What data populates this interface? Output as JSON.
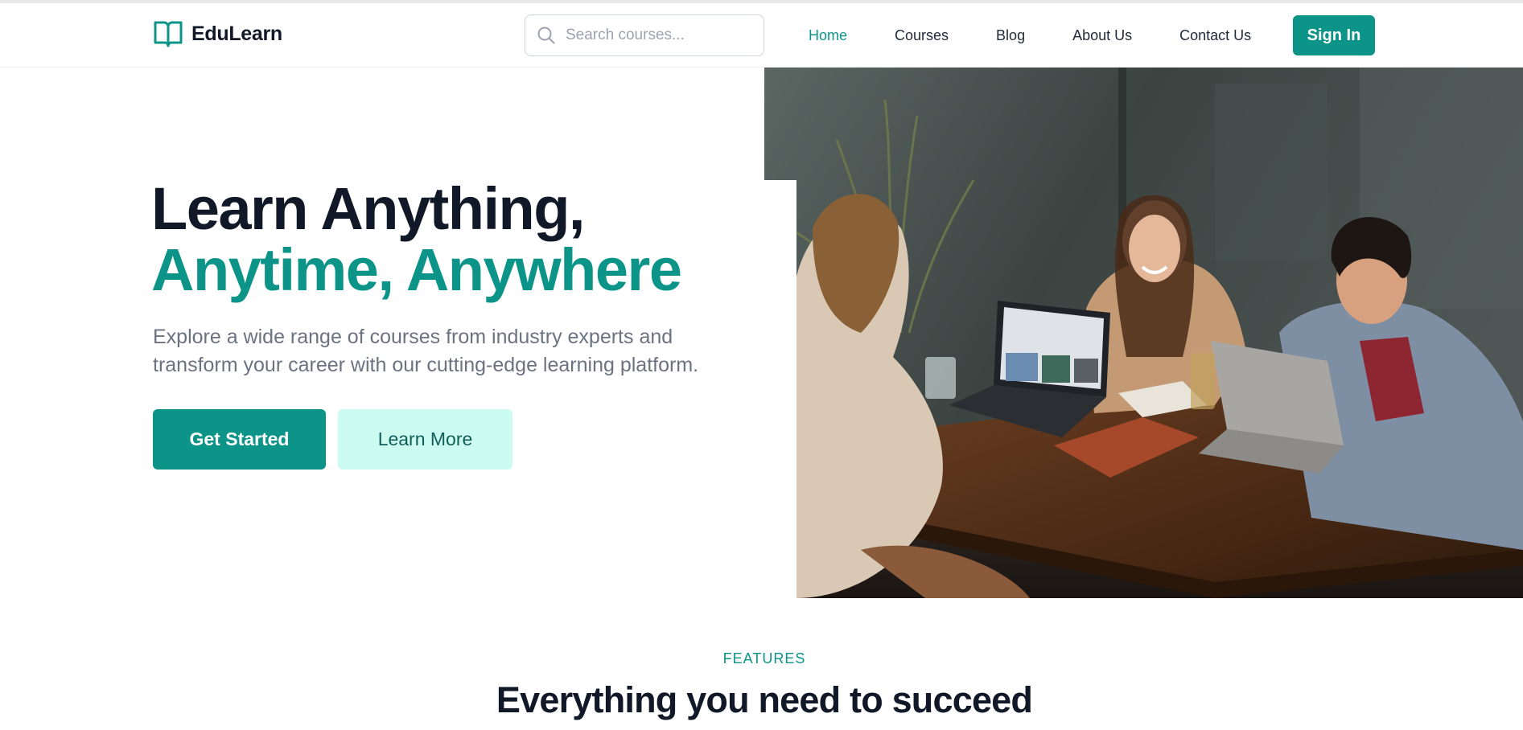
{
  "brand": {
    "name": "EduLearn",
    "icon": "open-book-icon",
    "color": "#0d9488"
  },
  "search": {
    "placeholder": "Search courses...",
    "value": "",
    "icon": "search-icon"
  },
  "nav": {
    "items": [
      {
        "label": "Home",
        "active": true
      },
      {
        "label": "Courses",
        "active": false
      },
      {
        "label": "Blog",
        "active": false
      },
      {
        "label": "About Us",
        "active": false
      },
      {
        "label": "Contact Us",
        "active": false
      }
    ],
    "signin_label": "Sign In"
  },
  "hero": {
    "title_line1": "Learn Anything,",
    "title_line2": "Anytime, Anywhere",
    "description": "Explore a wide range of courses from industry experts and transform your career with our cutting-edge learning platform.",
    "primary_button": "Get Started",
    "secondary_button": "Learn More",
    "image_subject": "three-people-laughing-with-laptops-at-table"
  },
  "features": {
    "label": "FEATURES",
    "title": "Everything you need to succeed"
  },
  "colors": {
    "accent": "#0d9488",
    "accent_light": "#ccfbf1",
    "heading": "#111827",
    "muted": "#6b7280"
  }
}
